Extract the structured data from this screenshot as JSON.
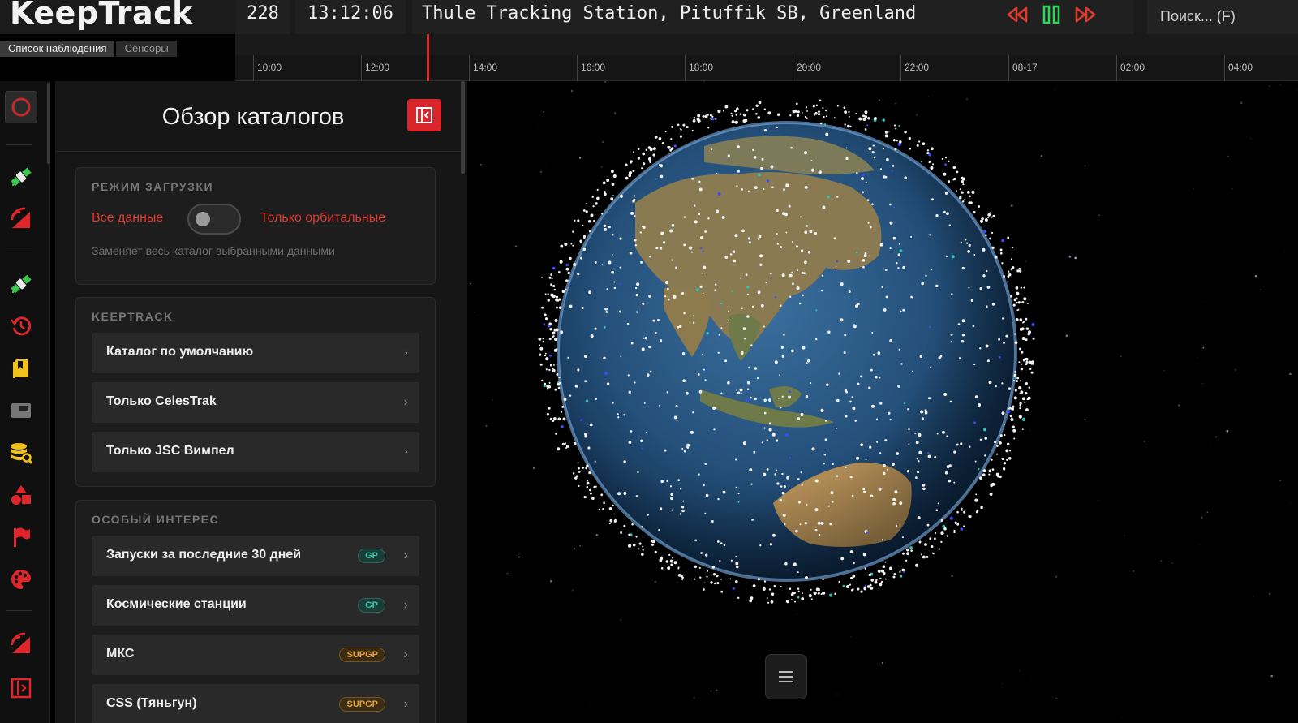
{
  "header": {
    "logo_text": "KeepTrack",
    "object_count": "228",
    "time": "13:12:06",
    "sensor": "Thule Tracking Station, Pituffik SB, Greenland",
    "controls": [
      "rewind-icon",
      "pause-icon",
      "fast-forward-icon"
    ],
    "search_placeholder": "Поиск... (F)"
  },
  "tabs": [
    {
      "label": "Список наблюдения",
      "active": true
    },
    {
      "label": "Сенсоры",
      "active": false
    }
  ],
  "timeline": {
    "ticks": [
      "10:00",
      "12:00",
      "14:00",
      "16:00",
      "18:00",
      "20:00",
      "22:00",
      "08-17",
      "02:00",
      "04:00"
    ]
  },
  "iconbar": [
    "circle-icon",
    "satellite-icon",
    "sensor-icon",
    "satellite-icon",
    "history-icon",
    "bookmark-icon",
    "window-icon",
    "database-search-icon",
    "shapes-icon",
    "flag-icon",
    "palette-icon",
    "sensor-icon",
    "collapse-icon"
  ],
  "panel": {
    "title": "Обзор каталогов",
    "load_mode": {
      "heading": "РЕЖИМ ЗАГРУЗКИ",
      "left_label": "Все данные",
      "right_label": "Только орбитальные",
      "hint": "Заменяет весь каталог выбранными данными"
    },
    "keeptrack": {
      "heading": "KEEPTRACK",
      "items": [
        "Каталог по умолчанию",
        "Только CelesTrak",
        "Только JSC Вимпел"
      ]
    },
    "special": {
      "heading": "ОСОБЫЙ ИНТЕРЕС",
      "items": [
        {
          "label": "Запуски за последние 30 дней",
          "badge": "GP"
        },
        {
          "label": "Космические станции",
          "badge": "GP"
        },
        {
          "label": "МКС",
          "badge": "SUPGP"
        },
        {
          "label": "CSS (Тяньгун)",
          "badge": "SUPGP"
        }
      ]
    }
  },
  "colors": {
    "accent": "#e23a2e",
    "play_green": "#35d35a",
    "gp_badge": "#36c7a8",
    "supgp_badge": "#e8a33a"
  }
}
